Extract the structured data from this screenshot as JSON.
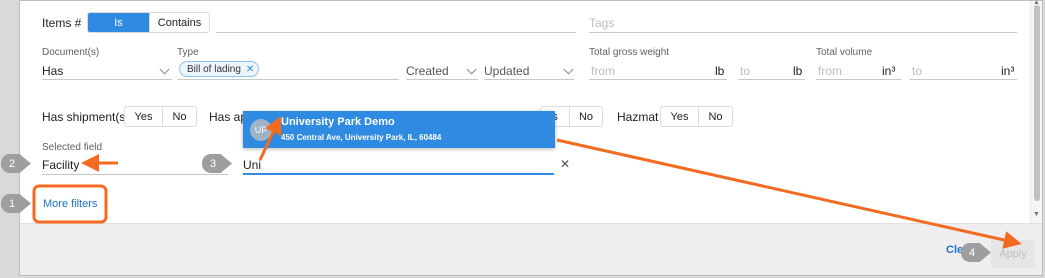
{
  "filters": {
    "items_label": "Items #",
    "items_mode": {
      "options": [
        "Is",
        "Contains"
      ],
      "selected": "Is"
    },
    "tags_placeholder": "Tags",
    "documents": {
      "label": "Document(s)",
      "value": "Has"
    },
    "type": {
      "label": "Type",
      "chip": "Bill of lading"
    },
    "created": "Created",
    "updated": "Updated",
    "total_gross_weight": {
      "label": "Total gross weight",
      "from": "from",
      "to": "to",
      "unit": "lb"
    },
    "total_volume": {
      "label": "Total volume",
      "from": "from",
      "to": "to",
      "unit": "in³"
    },
    "has_shipments": {
      "label": "Has shipment(s)",
      "yes": "Yes",
      "no": "No"
    },
    "has_ap": {
      "label": "Has ap",
      "no": "No",
      "partial_yes": "s"
    },
    "hazmat": {
      "label": "Hazmat",
      "yes": "Yes",
      "no": "No"
    },
    "selected_field": {
      "label": "Selected field",
      "value": "Facility"
    },
    "search_value": "Uni",
    "more_filters": "More filters"
  },
  "autocomplete": {
    "initials": "UP",
    "name": "University Park Demo",
    "address": "450 Central Ave, University Park, IL, 60484"
  },
  "footer": {
    "clear_partial": "Cle",
    "apply": "Apply"
  },
  "callouts": [
    "1",
    "2",
    "3",
    "4"
  ],
  "colors": {
    "accent": "#2f8ae2",
    "annotation": "#f26b21",
    "callout": "#9e9e9e"
  }
}
